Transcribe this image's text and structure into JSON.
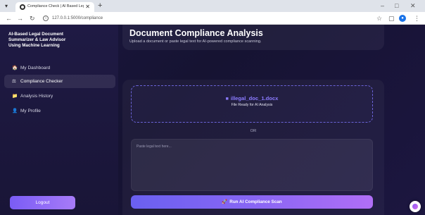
{
  "browser": {
    "tab_title": "Compliance Check | AI Based Leg...",
    "tab_close": "✕",
    "new_tab": "+",
    "url": "127.0.0.1:5000/compliance",
    "icons": [
      "menu-icon",
      "favicon-icon",
      "back-icon",
      "forward-icon",
      "reload-icon",
      "site-info-icon",
      "star-icon",
      "extensions-icon",
      "profile-icon",
      "more-icon",
      "minimize-icon",
      "maximize-icon",
      "close-icon"
    ]
  },
  "sidebar": {
    "brand_lines": [
      "AI-Based Legal Document",
      "Summarizer & Law Advisor",
      "Using Machine Learning"
    ],
    "items": [
      {
        "icon": "🏠",
        "label": "My Dashboard",
        "active": false
      },
      {
        "icon": "⚖",
        "label": "Compliance Checker",
        "active": true
      },
      {
        "icon": "📁",
        "label": "Analysis History",
        "active": false
      },
      {
        "icon": "👤",
        "label": "My Profile",
        "active": false
      }
    ],
    "logout_label": "Logout"
  },
  "header": {
    "title": "Document Compliance Analysis",
    "subtitle": "Upload a document or paste legal text for AI-powered compliance scanning."
  },
  "upload": {
    "file_name": "illegal_doc_1.docx",
    "status": "File Ready for AI Analysis"
  },
  "divider_text": "OR",
  "text_input": {
    "placeholder": "Paste legal text here...",
    "value": ""
  },
  "scan_button": {
    "icon": "🚀",
    "label": "Run AI Compliance Scan"
  },
  "colors": {
    "accent": "#7a5cf5",
    "accent_light": "#8b7bff",
    "background": "#161332"
  }
}
